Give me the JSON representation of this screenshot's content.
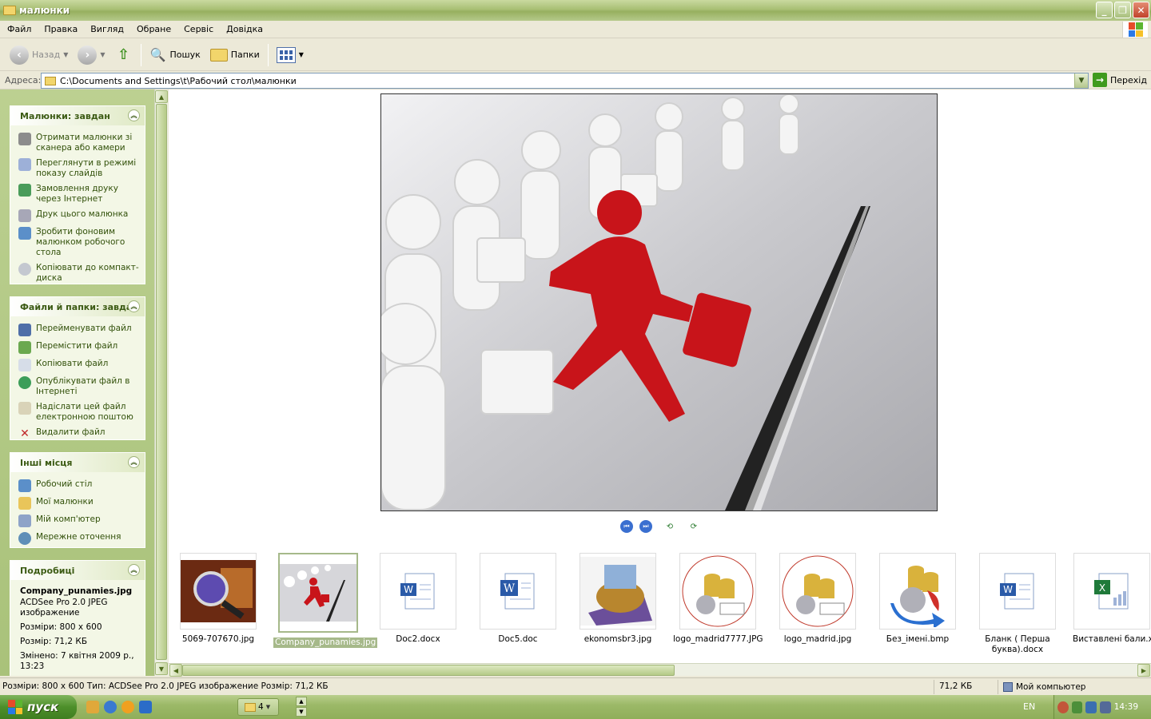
{
  "window": {
    "title": "малюнки"
  },
  "menu": [
    "Файл",
    "Правка",
    "Вигляд",
    "Обране",
    "Сервіс",
    "Довідка"
  ],
  "toolbar": {
    "back": "Назад",
    "search": "Пошук",
    "folders": "Папки"
  },
  "address": {
    "label": "Адреса:",
    "path": "C:\\Documents and Settings\\t\\Рабочий стол\\малюнки",
    "go": "Перехід"
  },
  "tasks_pictures": {
    "title": "Малюнки: завдан",
    "items": [
      "Отримати малюнки зі сканера або камери",
      "Переглянути в режимі показу слайдів",
      "Замовлення друку через Інтернет",
      "Друк цього малюнка",
      "Зробити фоновим малюнком робочого стола",
      "Копіювати до компакт-диска"
    ]
  },
  "tasks_files": {
    "title": "Файли й папки: завдан",
    "items": [
      "Перейменувати файл",
      "Перемістити файл",
      "Копіювати файл",
      "Опублікувати файл в Інтернеті",
      "Надіслати цей файл електронною поштою",
      "Видалити файл"
    ]
  },
  "other_places": {
    "title": "Інші місця",
    "items": [
      "Робочий стіл",
      "Мої малюнки",
      "Мій комп'ютер",
      "Мережне оточення"
    ]
  },
  "details": {
    "title": "Подробиці",
    "filename": "Company_punamies.jpg",
    "type": "ACDSee Pro 2.0 JPEG изображение",
    "size_dims": "Розміри: 800 x 600",
    "size": "Розмір: 71,2 КБ",
    "modified": "Змінено: 7 квітня 2009 р., 13:23"
  },
  "thumbnails": [
    {
      "name": "5069-707670.jpg",
      "kind": "photo-magnifier",
      "selected": false
    },
    {
      "name": "Company_punamies.jpg",
      "kind": "photo-runner",
      "selected": true
    },
    {
      "name": "Doc2.docx",
      "kind": "word-doc",
      "selected": false
    },
    {
      "name": "Doc5.doc",
      "kind": "word-doc-old",
      "selected": false
    },
    {
      "name": "ekonomsbr3.jpg",
      "kind": "photo-money",
      "selected": false
    },
    {
      "name": "logo_madrid7777.JPG",
      "kind": "logo-coins",
      "selected": false
    },
    {
      "name": "logo_madrid.jpg",
      "kind": "logo-coins",
      "selected": false
    },
    {
      "name": "Без_імені.bmp",
      "kind": "logo-coins-arrow",
      "selected": false
    },
    {
      "name": "Бланк ( Перша буква).docx",
      "kind": "word-doc",
      "selected": false
    },
    {
      "name": "Виставлені бали.xl",
      "kind": "excel-doc",
      "selected": false
    }
  ],
  "status": {
    "main": "Розміри: 800 x 600 Тип: ACDSee Pro 2.0 JPEG изображение Розмір: 71,2 КБ",
    "size": "71,2 КБ",
    "location": "Мой компьютер"
  },
  "taskbar": {
    "start": "пуск",
    "group_count": "4",
    "lang": "EN",
    "clock": "14:39"
  }
}
